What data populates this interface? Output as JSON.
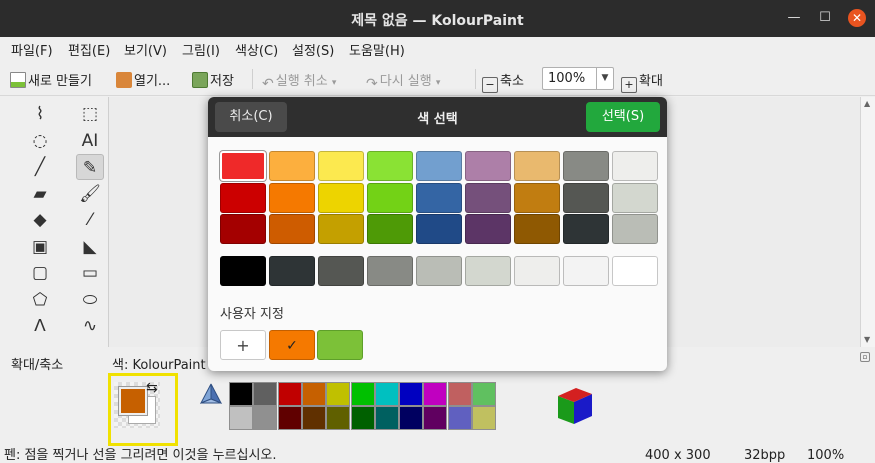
{
  "window": {
    "title": "제목 없음 — KolourPaint"
  },
  "menu": [
    "파일(F)",
    "편집(E)",
    "보기(V)",
    "그림(I)",
    "색상(C)",
    "설정(S)",
    "도움말(H)"
  ],
  "toolbar": {
    "new_label": "새로 만들기",
    "open_label": "열기...",
    "save_label": "저장",
    "undo_label": "실행 취소",
    "redo_label": "다시 실행",
    "zoom_out_label": "축소",
    "zoom_value": "100%",
    "zoom_in_label": "확대"
  },
  "tools": [
    {
      "name": "free-form-select-icon",
      "glyph": "⌇"
    },
    {
      "name": "rect-select-icon",
      "glyph": "⬚"
    },
    {
      "name": "ellipse-select-icon",
      "glyph": "◌"
    },
    {
      "name": "text-tool-icon",
      "glyph": "AI"
    },
    {
      "name": "line-tool-icon",
      "glyph": "╱"
    },
    {
      "name": "pen-tool-icon",
      "glyph": "✎"
    },
    {
      "name": "eraser-tool-icon",
      "glyph": "▰"
    },
    {
      "name": "brush-tool-icon",
      "glyph": "🖌"
    },
    {
      "name": "flood-fill-icon",
      "glyph": "◆"
    },
    {
      "name": "color-picker-icon",
      "glyph": "⁄"
    },
    {
      "name": "color-eraser-icon",
      "glyph": "▣"
    },
    {
      "name": "spraycan-icon",
      "glyph": "◣"
    },
    {
      "name": "rounded-rect-icon",
      "glyph": "▢"
    },
    {
      "name": "rectangle-icon",
      "glyph": "▭"
    },
    {
      "name": "polygon-icon",
      "glyph": "⬠"
    },
    {
      "name": "ellipse-icon",
      "glyph": "⬭"
    },
    {
      "name": "polyline-icon",
      "glyph": "ᐱ"
    },
    {
      "name": "curve-icon",
      "glyph": "∿"
    }
  ],
  "docks": {
    "zoom_label": "확대/축소",
    "color_label": "색: KolourPaint"
  },
  "foreground_color": "#c66000",
  "palette": {
    "top": [
      "#000000",
      "#606060",
      "#c00000",
      "#c66000",
      "#c0c000",
      "#00c000",
      "#00c0c0",
      "#0000c0",
      "#c000c0",
      "#c06060",
      "#60c060"
    ],
    "bottom": [
      "#c0c0c0",
      "#909090",
      "#600000",
      "#603000",
      "#606000",
      "#006000",
      "#006060",
      "#000060",
      "#600060",
      "#6060c0",
      "#c0c060"
    ]
  },
  "status": {
    "hint": "펜: 점을 찍거나 선을 그리려면 이것을 누르십시오.",
    "dimensions": "400 x 300",
    "depth": "32bpp",
    "zoom": "100%"
  },
  "dialog": {
    "title": "색 선택",
    "cancel_label": "취소(C)",
    "ok_label": "선택(S)",
    "custom_label": "사용자 지정",
    "add_symbol": "+",
    "check_symbol": "✓",
    "swatch_rows": [
      [
        "#ef2929",
        "#fcaf3e",
        "#fce94f",
        "#8ae234",
        "#729fcf",
        "#ad7fa8",
        "#e9b96e",
        "#888a85",
        "#eeeeec"
      ],
      [
        "#cc0000",
        "#f57900",
        "#edd400",
        "#73d216",
        "#3465a4",
        "#75507b",
        "#c17d11",
        "#555753",
        "#d3d7cf"
      ],
      [
        "#a40000",
        "#ce5c00",
        "#c4a000",
        "#4e9a06",
        "#204a87",
        "#5c3566",
        "#8f5902",
        "#2e3436",
        "#babdb6"
      ]
    ],
    "gray_row": [
      "#000000",
      "#2e3436",
      "#555753",
      "#888a85",
      "#babdb6",
      "#d3d7cf",
      "#eeeeec",
      "#f3f3f3",
      "#ffffff"
    ],
    "custom_colors": [
      "#f57900",
      "#7cc138"
    ]
  }
}
